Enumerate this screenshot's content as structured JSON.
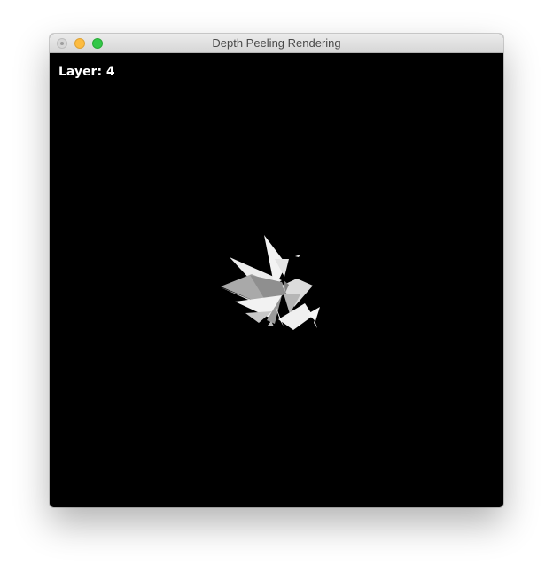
{
  "window": {
    "title": "Depth Peeling Rendering"
  },
  "titlebar": {
    "buttons": [
      {
        "name": "close",
        "color": "#d7d7d7"
      },
      {
        "name": "minimize",
        "color": "#fdbc40"
      },
      {
        "name": "zoom",
        "color": "#33c748"
      }
    ]
  },
  "viewport": {
    "background": "#000000",
    "layer_label": "Layer: 4"
  }
}
